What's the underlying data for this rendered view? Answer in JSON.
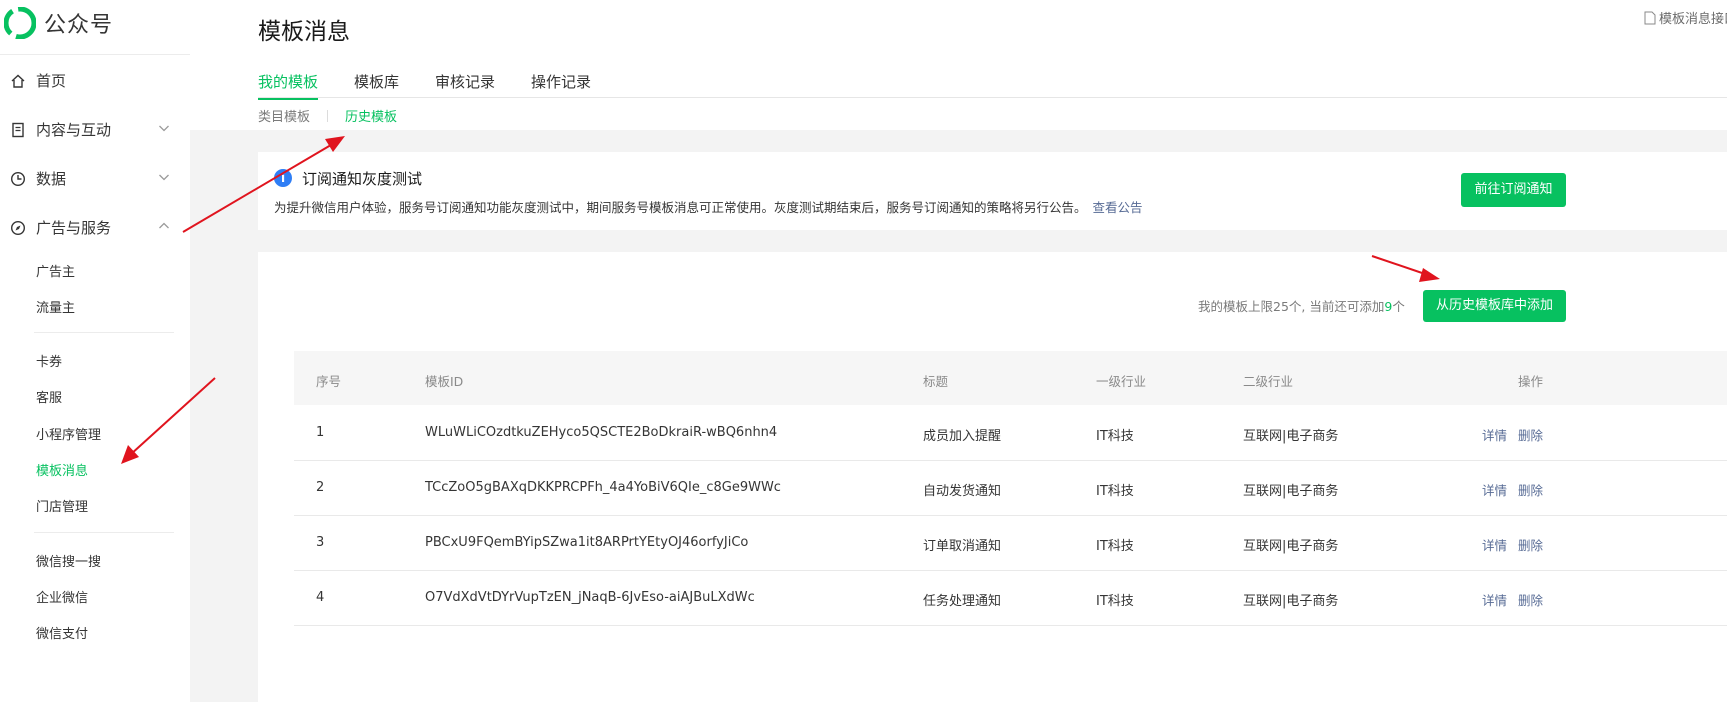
{
  "app": {
    "name": "公众号"
  },
  "sidebar": {
    "main_items": [
      {
        "label": "首页"
      },
      {
        "label": "内容与互动"
      },
      {
        "label": "数据"
      },
      {
        "label": "广告与服务"
      }
    ],
    "sub_items": [
      {
        "label": "广告主"
      },
      {
        "label": "流量主"
      },
      {
        "label": "卡券"
      },
      {
        "label": "客服"
      },
      {
        "label": "小程序管理"
      },
      {
        "label": "模板消息",
        "active": true
      },
      {
        "label": "门店管理"
      },
      {
        "label": "微信搜一搜"
      },
      {
        "label": "企业微信"
      },
      {
        "label": "微信支付"
      }
    ]
  },
  "page": {
    "title": "模板消息",
    "doc_link": "模板消息接口",
    "tabs": [
      {
        "label": "我的模板",
        "active": true
      },
      {
        "label": "模板库"
      },
      {
        "label": "审核记录"
      },
      {
        "label": "操作记录"
      }
    ],
    "subtabs": [
      {
        "label": "类目模板"
      },
      {
        "label": "历史模板",
        "active": true
      }
    ]
  },
  "notice": {
    "icon": "i",
    "title": "订阅通知灰度测试",
    "text": "为提升微信用户体验，服务号订阅通知功能灰度测试中，期间服务号模板消息可正常使用。灰度测试期结束后，服务号订阅通知的策略将另行公告。",
    "link": "查看公告",
    "button": "前往订阅通知"
  },
  "templates": {
    "limit_prefix": "我的模板上限25个, 当前还可添加",
    "limit_num": "9",
    "limit_suffix": "个",
    "add_button": "从历史模板库中添加",
    "columns": [
      "序号",
      "模板ID",
      "标题",
      "一级行业",
      "二级行业",
      "操作"
    ],
    "rows": [
      {
        "no": "1",
        "id": "WLuWLiCOzdtkuZEHyco5QSCTE2BoDkraiR-wBQ6nhn4",
        "title": "成员加入提醒",
        "industry1": "IT科技",
        "industry2": "互联网|电子商务",
        "detail": "详情",
        "delete": "删除"
      },
      {
        "no": "2",
        "id": "TCcZoO5gBAXqDKKPRCPFh_4a4YoBiV6QIe_c8Ge9WWc",
        "title": "自动发货通知",
        "industry1": "IT科技",
        "industry2": "互联网|电子商务",
        "detail": "详情",
        "delete": "删除"
      },
      {
        "no": "3",
        "id": "PBCxU9FQemBYipSZwa1it8ARPrtYEtyOJ46orfyJiCo",
        "title": "订单取消通知",
        "industry1": "IT科技",
        "industry2": "互联网|电子商务",
        "detail": "详情",
        "delete": "删除"
      },
      {
        "no": "4",
        "id": "O7VdXdVtDYrVupTzEN_jNaqB-6JvEso-aiAJBuLXdWc",
        "title": "任务处理通知",
        "industry1": "IT科技",
        "industry2": "互联网|电子商务",
        "detail": "详情",
        "delete": "删除"
      }
    ]
  },
  "colors": {
    "accent": "#07c160",
    "link": "#576b95",
    "annotation_arrow": "#e0141e"
  }
}
